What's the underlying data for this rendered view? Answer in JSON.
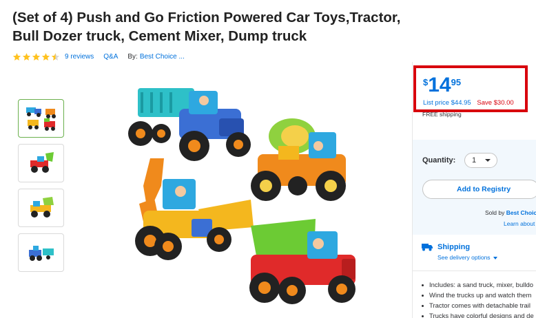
{
  "product": {
    "title": "(Set of 4) Push and Go Friction Powered Car Toys,Tractor, Bull Dozer truck, Cement Mixer, Dump truck",
    "rating": 4.5,
    "reviews_label": "9 reviews",
    "qa_label": "Q&A",
    "by_label": "By:",
    "brand_label": "Best Choice ..."
  },
  "gallery": {
    "thumbnails": [
      {
        "icon": "four-trucks-thumbnail",
        "selected": true
      },
      {
        "icon": "bulldozer-thumbnail",
        "selected": false
      },
      {
        "icon": "cement-mixer-thumbnail",
        "selected": false
      },
      {
        "icon": "tractor-thumbnail",
        "selected": false
      }
    ],
    "main_image": "four-toy-trucks-image"
  },
  "pricing": {
    "currency": "$",
    "dollars": "14",
    "cents": "95",
    "list_price": "List price $44.95",
    "save": "Save $30.00",
    "free_shipping": "FREE shipping"
  },
  "purchase": {
    "quantity_label": "Quantity:",
    "quantity_value": "1",
    "registry_button": "Add to Registry",
    "sold_by_label": "Sold by",
    "seller": "Best Choice",
    "learn_more": "Learn about"
  },
  "shipping": {
    "title": "Shipping",
    "options_link": "See delivery options"
  },
  "features": [
    "Includes: a sand truck, mixer, bulldo",
    "Wind the trucks up and watch them",
    "Tractor comes with detachable trail",
    "Trucks have colorful designs and de"
  ],
  "colors": {
    "link_blue": "#0071dc",
    "highlight_red": "#d8000c",
    "star_gold": "#ffc220",
    "panel_bg": "#f2f8fd"
  }
}
